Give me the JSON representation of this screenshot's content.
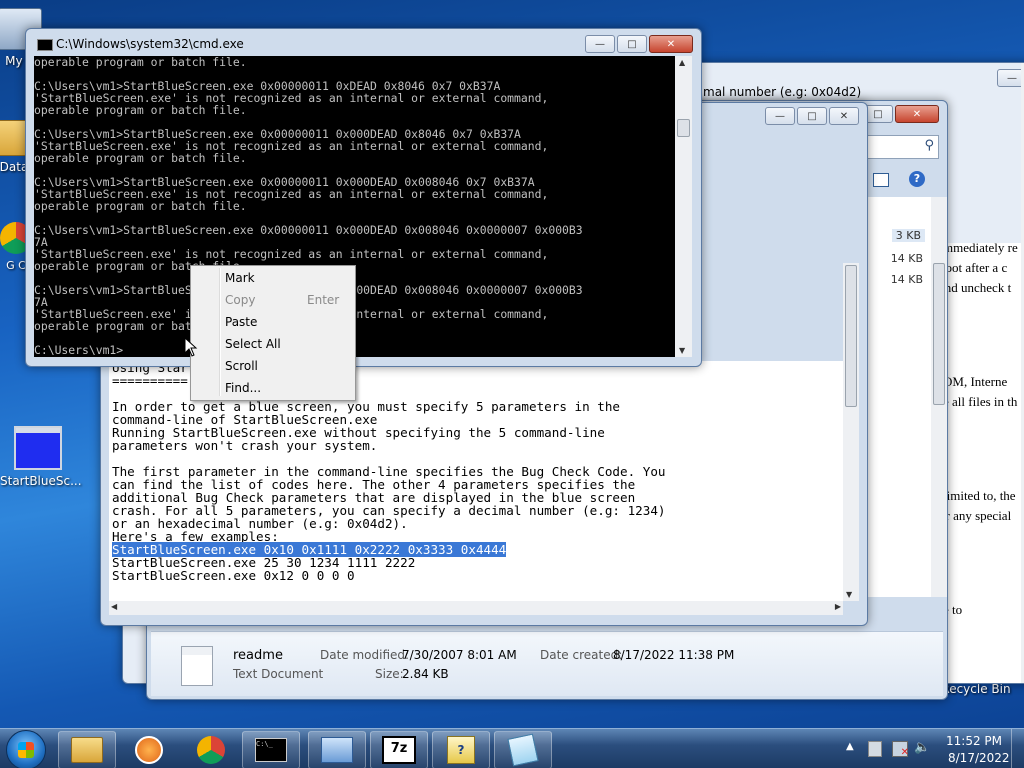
{
  "desktop": {
    "icons": [
      {
        "label": "My C"
      },
      {
        "label": "Data"
      },
      {
        "label": "G C"
      },
      {
        "label": "StartBlueSc..."
      },
      {
        "label": "Recycle Bin"
      }
    ]
  },
  "explorer_back": {
    "text_lines": [
      "mal number (e.g: 0x04d2)",
      "mmediately re",
      "boot after a c",
      "and uncheck t",
      "OM, Interne",
      "e all files in th",
      "limited to, the",
      "or any special",
      "e to"
    ]
  },
  "explorer": {
    "file_sizes": [
      "3 KB",
      "14 KB",
      "14 KB"
    ],
    "details": {
      "name": "readme",
      "type": "Text Document",
      "modified_label": "Date modified:",
      "modified_value": "7/30/2007 8:01 AM",
      "created_label": "Date created:",
      "created_value": "8/17/2022 11:38 PM",
      "size_label": "Size:",
      "size_value": "2.84 KB"
    }
  },
  "notepad": {
    "lines": [
      "Using Star",
      "==========",
      "",
      "In order to get a blue screen, you must specify 5 parameters in the",
      "command-line of StartBlueScreen.exe",
      "Running StartBlueScreen.exe without specifying the 5 command-line",
      "parameters won't crash your system.",
      "",
      "The first parameter in the command-line specifies the Bug Check Code. You",
      "can find the list of codes here. The other 4 parameters specifies the",
      "additional Bug Check parameters that are displayed in the blue screen",
      "crash. For all 5 parameters, you can specify a decimal number (e.g: 1234)",
      "or an hexadecimal number (e.g: 0x04d2).",
      "Here's a few examples:"
    ],
    "selected_line": "StartBlueScreen.exe 0x10 0x1111 0x2222 0x3333 0x4444",
    "after_lines": [
      "StartBlueScreen.exe 25 30 1234 1111 2222",
      "StartBlueScreen.exe 0x12 0 0 0 0"
    ]
  },
  "cmd": {
    "title": "C:\\Windows\\system32\\cmd.exe",
    "lines": [
      "operable program or batch file.",
      "",
      "C:\\Users\\vm1>StartBlueScreen.exe 0x00000011 0xDEAD 0x8046 0x7 0xB37A",
      "'StartBlueScreen.exe' is not recognized as an internal or external command,",
      "operable program or batch file.",
      "",
      "C:\\Users\\vm1>StartBlueScreen.exe 0x00000011 0x000DEAD 0x8046 0x7 0xB37A",
      "'StartBlueScreen.exe' is not recognized as an internal or external command,",
      "operable program or batch file.",
      "",
      "C:\\Users\\vm1>StartBlueScreen.exe 0x00000011 0x000DEAD 0x008046 0x7 0xB37A",
      "'StartBlueScreen.exe' is not recognized as an internal or external command,",
      "operable program or batch file.",
      "",
      "C:\\Users\\vm1>StartBlueScreen.exe 0x00000011 0x000DEAD 0x008046 0x0000007 0x000B3",
      "7A",
      "'StartBlueScreen.exe' is not recognized as an internal or external command,",
      "operable program or batch file.",
      "",
      "C:\\Users\\vm1>StartBlueScreen.exe 0x00000011 0x000DEAD 0x008046 0x0000007 0x000B3",
      "7A",
      "'StartBlueScreen.exe' is not recognized as an internal or external command,",
      "operable program or batch file.",
      "",
      "C:\\Users\\vm1>"
    ]
  },
  "context_menu": {
    "items": [
      {
        "label": "Mark",
        "shortcut": "",
        "enabled": true
      },
      {
        "label": "Copy",
        "shortcut": "Enter",
        "enabled": false
      },
      {
        "label": "Paste",
        "shortcut": "",
        "enabled": true
      },
      {
        "label": "Select All",
        "shortcut": "",
        "enabled": true
      },
      {
        "label": "Scroll",
        "shortcut": "",
        "enabled": true
      },
      {
        "label": "Find...",
        "shortcut": "",
        "enabled": true
      }
    ]
  },
  "taskbar": {
    "clock_time": "11:52 PM",
    "clock_date": "8/17/2022",
    "buttons": [
      "start-orb",
      "file-explorer",
      "media-player",
      "chrome",
      "cmd",
      "network-manager",
      "7zip",
      "help-file",
      "notepad"
    ]
  },
  "colors": {
    "selection": "#3a78d6",
    "console_bg": "#000000",
    "console_fg": "#c0c0c0"
  }
}
